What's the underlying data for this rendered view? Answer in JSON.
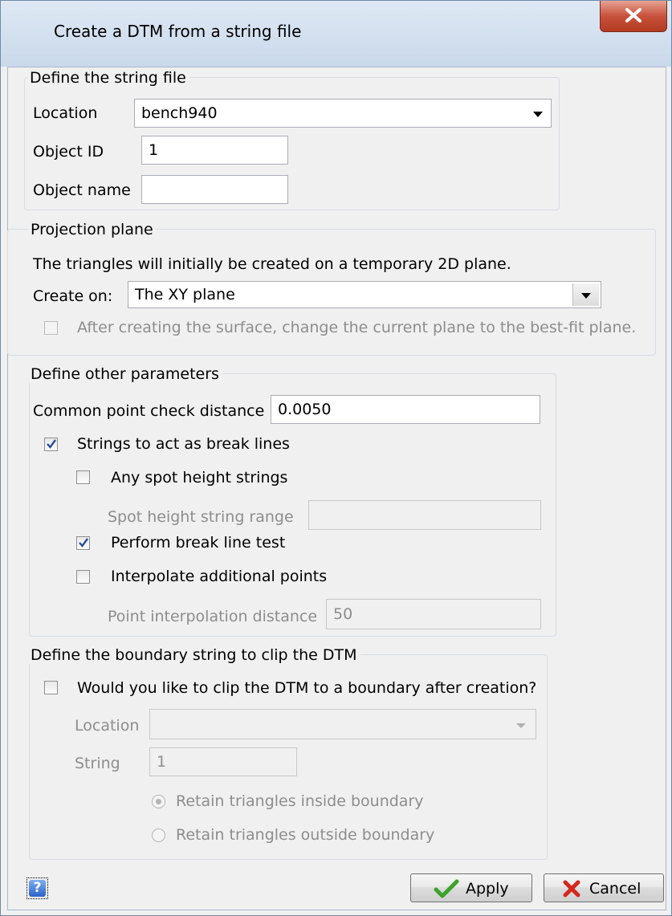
{
  "window": {
    "title": "Create a DTM from a string file"
  },
  "string_file": {
    "legend": "Define the string file",
    "location_label": "Location",
    "location_value": "bench940",
    "object_id_label": "Object ID",
    "object_id_value": "1",
    "object_name_label": "Object name",
    "object_name_value": ""
  },
  "projection": {
    "legend": "Projection plane",
    "description": "The triangles will initially be created on a temporary 2D plane.",
    "create_on_label": "Create on:",
    "create_on_value": "The XY plane",
    "best_fit_label": "After creating the surface, change the current plane to the best-fit plane.",
    "best_fit_checked": false
  },
  "other_params": {
    "legend": "Define other parameters",
    "common_point_label": "Common point check distance",
    "common_point_value": "0.0050",
    "break_lines_label": "Strings to act as break lines",
    "break_lines_checked": true,
    "spot_height_label": "Any spot height strings",
    "spot_height_checked": false,
    "spot_range_label": "Spot height string range",
    "spot_range_value": "",
    "break_test_label": "Perform break line test",
    "break_test_checked": true,
    "interpolate_label": "Interpolate additional points",
    "interpolate_checked": false,
    "interp_distance_label": "Point interpolation distance",
    "interp_distance_value": "50"
  },
  "boundary": {
    "legend": "Define the boundary string to clip the DTM",
    "clip_label": "Would you like to clip the DTM to a boundary after creation?",
    "clip_checked": false,
    "location_label": "Location",
    "location_value": "",
    "string_label": "String",
    "string_value": "1",
    "retain_inside_label": "Retain triangles inside boundary",
    "retain_outside_label": "Retain triangles outside boundary",
    "retain_selected": "inside"
  },
  "buttons": {
    "apply_label": "Apply",
    "cancel_label": "Cancel",
    "help_glyph": "?"
  },
  "colors": {
    "close_button": "#c8523c",
    "checkmark": "#2a4e9e",
    "apply_icon": "#3fa22b",
    "cancel_icon": "#d2281e"
  },
  "icons": {
    "close": "close-icon",
    "apply": "checkmark-icon",
    "cancel": "cross-icon",
    "help": "help-icon"
  }
}
